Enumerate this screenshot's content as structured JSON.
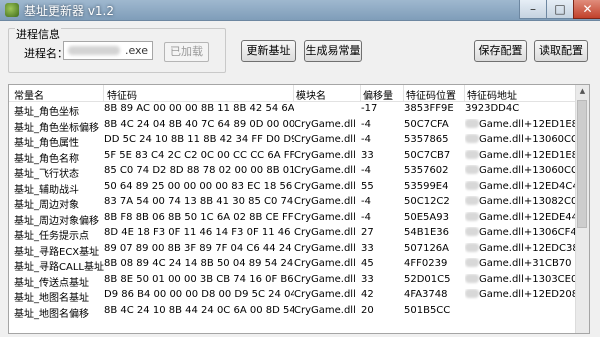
{
  "window": {
    "title": "基址更新器 v1.2",
    "minimize": "–",
    "maximize": "□",
    "close": "✕"
  },
  "process_group": {
    "title": "进程信息",
    "process_label": "进程名：",
    "process_input_value": ".exe",
    "loaded_button": "已加载"
  },
  "toolbar": {
    "update_button": "更新基址",
    "generate_button": "生成易常量",
    "save_button": "保存配置",
    "read_button": "读取配置"
  },
  "table": {
    "headers": [
      "常量名",
      "特征码",
      "模块名",
      "偏移量",
      "特征码位置",
      "特征码地址"
    ],
    "rows": [
      [
        "基址_角色坐标",
        "8B 89 AC 00 00 00 8B 11 8B 42 54 6A 0...",
        "",
        "-17",
        "3853FF9E",
        "3923DD4C"
      ],
      [
        "基址_角色坐标偏移",
        "8B 4C 24 04 8B 40 7C 64 89 0D 00 00 0...",
        "CryGame.dll",
        "-4",
        "50C7CFA",
        "Game.dll+12ED1E8"
      ],
      [
        "基址_角色属性",
        "DD 5C 24 10 8B 11 8B 42 34 FF D0 D9 5...",
        "CryGame.dll",
        "-4",
        "5357865",
        "Game.dll+13060CC"
      ],
      [
        "基址_角色名称",
        "5F 5E 83 C4 2C C2 0C 00 CC CC 6A FF",
        "CryGame.dll",
        "33",
        "50C7CB7",
        "Game.dll+12ED1E8"
      ],
      [
        "基址_飞行状态",
        "85 C0 74 D2 8D 88 78 02 00 00 8B 01 8...",
        "CryGame.dll",
        "-4",
        "5357602",
        "Game.dll+13060CC"
      ],
      [
        "基址_辅助战斗",
        "50 64 89 25 00 00 00 00 83 EC 18 56 8...",
        "CryGame.dll",
        "55",
        "53599E4",
        "Game.dll+12ED4C4"
      ],
      [
        "基址_周边对象",
        "83 7A 54 00 74 13 8B 41 30 85 C0 74 0...",
        "CryGame.dll",
        "-4",
        "50C12C2",
        "Game.dll+13082C0"
      ],
      [
        "基址_周边对象偏移",
        "8B F8 8B 06 8B 50 1C 6A 02 8B CE FF D...",
        "CryGame.dll",
        "-4",
        "50E5A93",
        "Game.dll+12EDE44"
      ],
      [
        "基址_任务提示点",
        "8D 4E 18 F3 0F 11 46 14 F3 0F 11 46 10...",
        "CryGame.dll",
        "27",
        "54B1E36",
        "Game.dll+1306CF4"
      ],
      [
        "基址_寻路ECX基址",
        "89 07 89 00 8B 3F 89 7F 04 C6 44 24 4...",
        "CryGame.dll",
        "33",
        "507126A",
        "Game.dll+12EDC38"
      ],
      [
        "基址_寻路CALL基址",
        "8B 08 89 4C 24 14 8B 50 04 89 54 24 1...",
        "CryGame.dll",
        "45",
        "4FF0239",
        "Game.dll+31CB70"
      ],
      [
        "基址_传送点基址",
        "8B 8E 50 01 00 00 3B CB 74 16 0F B6 8...",
        "CryGame.dll",
        "33",
        "52D01C5",
        "Game.dll+1303CE0"
      ],
      [
        "基址_地图名基址",
        "D9 86 B4 00 00 00 D8 00 D9 5C 24 04 ...",
        "CryGame.dll",
        "42",
        "4FA3748",
        "Game.dll+12ED208"
      ],
      [
        "基址_地图名偏移",
        "8B 4C 24 10 8B 44 24 0C 6A 00 8D 54 ...",
        "CryGame.dll",
        "20",
        "501B5CC",
        ""
      ]
    ]
  }
}
